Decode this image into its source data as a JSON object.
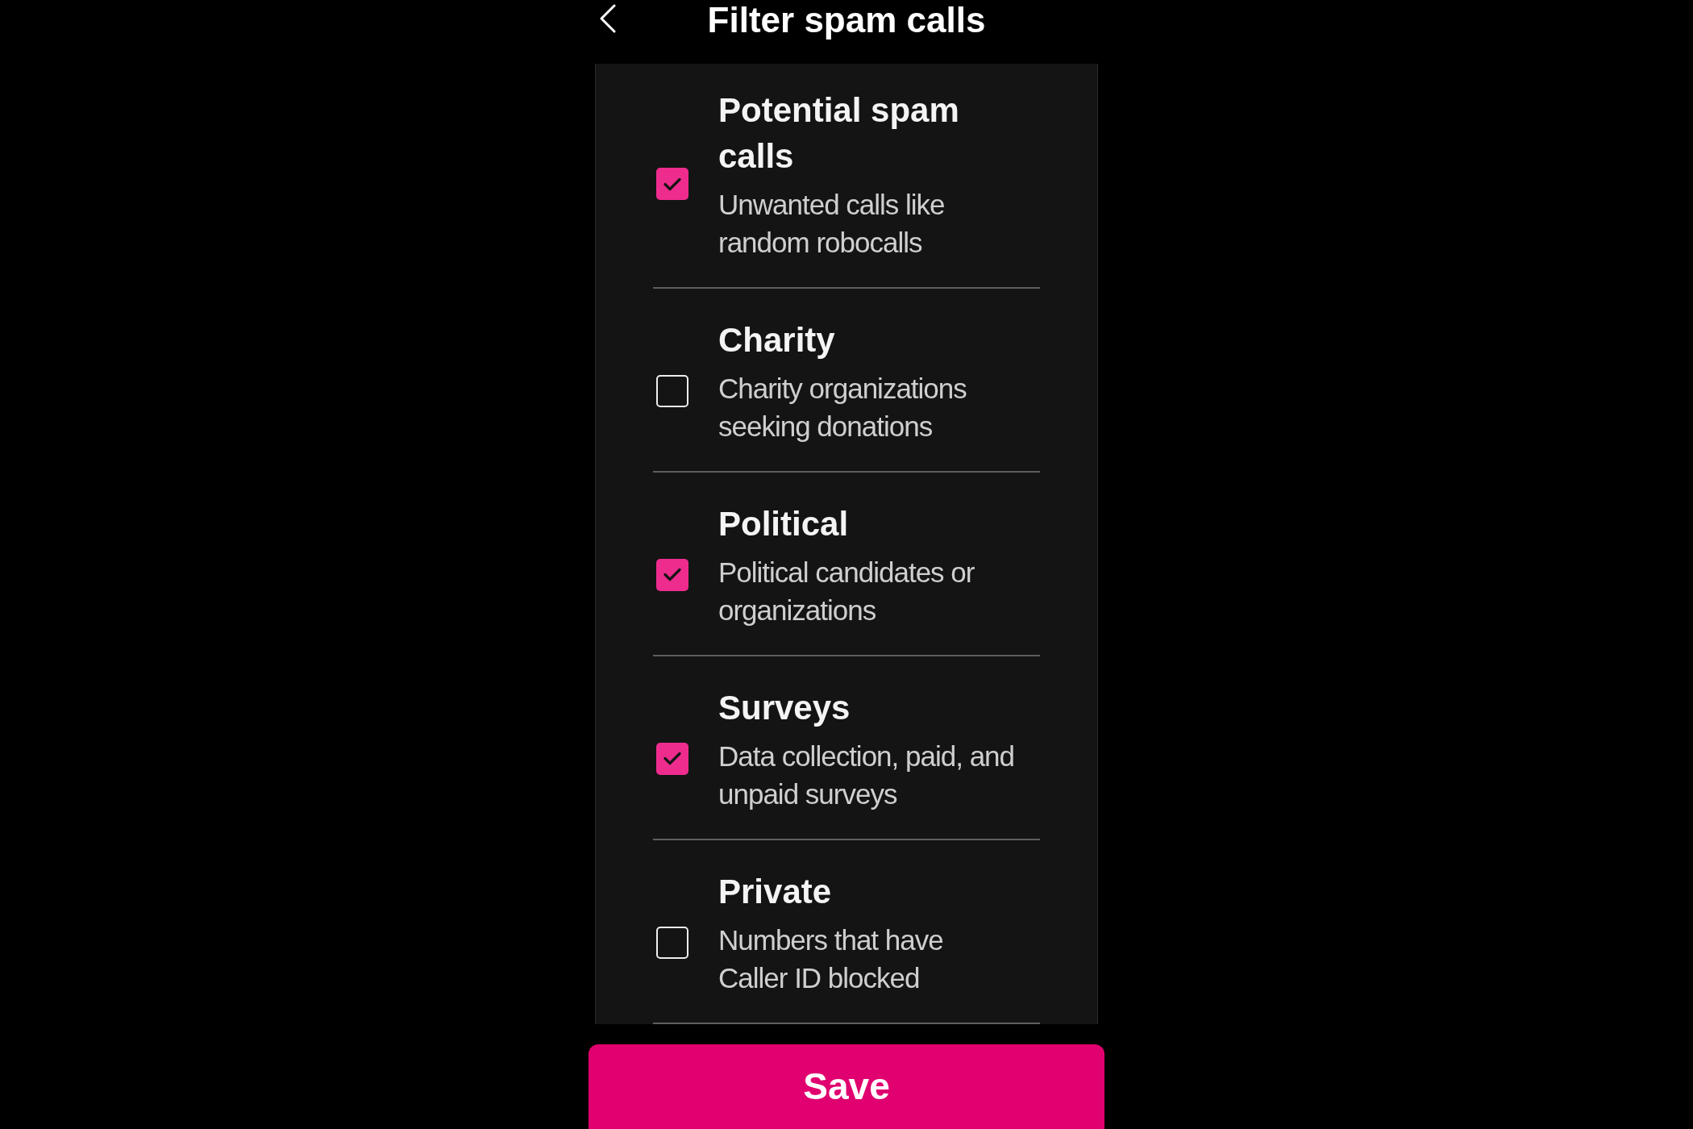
{
  "header": {
    "title": "Filter spam calls"
  },
  "filters": [
    {
      "title": "Potential spam calls",
      "description": "Unwanted calls like random robocalls",
      "checked": true
    },
    {
      "title": "Charity",
      "description": "Charity organizations seeking donations",
      "checked": false
    },
    {
      "title": "Political",
      "description": "Political candidates or organizations",
      "checked": true
    },
    {
      "title": "Surveys",
      "description": "Data collection, paid, and unpaid surveys",
      "checked": true
    },
    {
      "title": "Private",
      "description": "Numbers that have Caller ID blocked",
      "checked": false
    }
  ],
  "save_button": {
    "label": "Save"
  }
}
